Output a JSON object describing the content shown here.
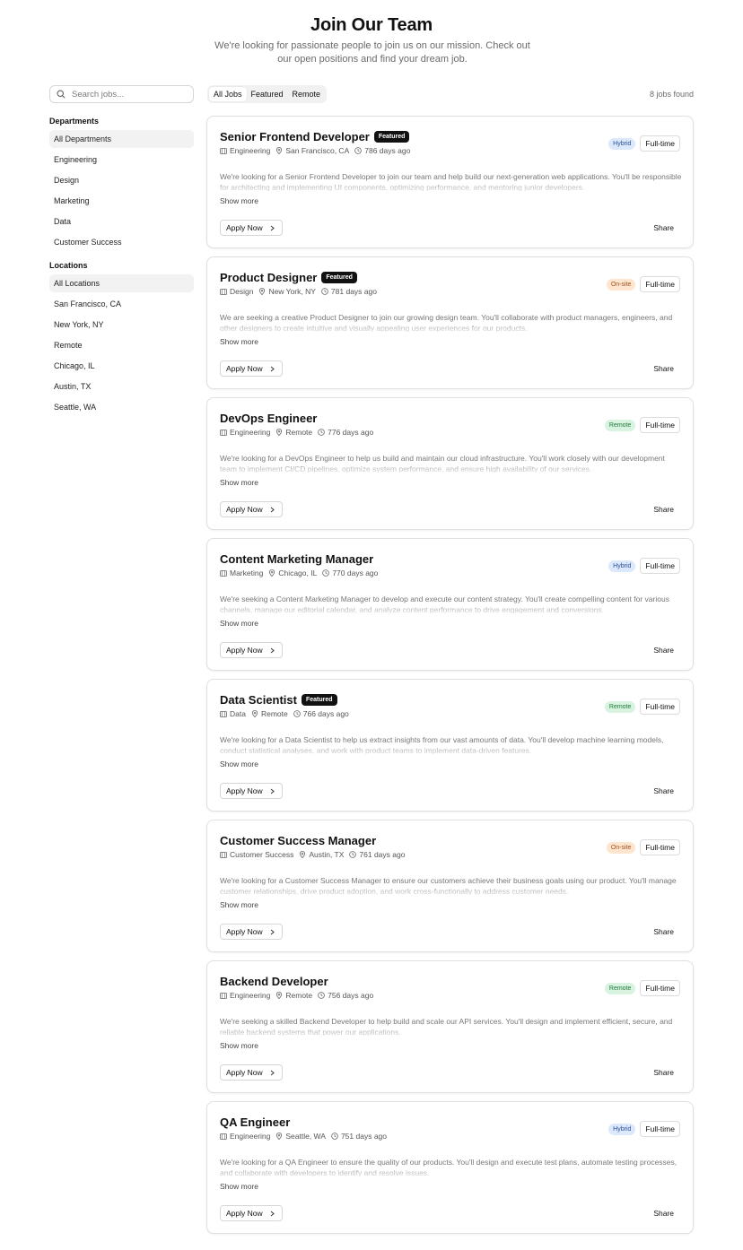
{
  "header": {
    "title": "Join Our Team",
    "subtitle": "We're looking for passionate people to join us on our mission. Check out our open positions and find your dream job."
  },
  "sidebar": {
    "search_placeholder": "Search jobs...",
    "departments_heading": "Departments",
    "departments": [
      "All Departments",
      "Engineering",
      "Design",
      "Marketing",
      "Data",
      "Customer Success"
    ],
    "locations_heading": "Locations",
    "locations": [
      "All Locations",
      "San Francisco, CA",
      "New York, NY",
      "Remote",
      "Chicago, IL",
      "Austin, TX",
      "Seattle, WA"
    ]
  },
  "filters": {
    "tabs": [
      "All Jobs",
      "Featured",
      "Remote"
    ],
    "count": "8 jobs found"
  },
  "labels": {
    "show_more": "Show more",
    "apply": "Apply Now",
    "share": "Share"
  },
  "jobs": [
    {
      "title": "Senior Frontend Developer",
      "featured": "Featured",
      "department": "Engineering",
      "location": "San Francisco, CA",
      "posted": "786 days ago",
      "work_mode": "Hybrid",
      "type": "Full-time",
      "description": "We're looking for a Senior Frontend Developer to join our team and help build our next-generation web applications. You'll be responsible for architecting and implementing UI components, optimizing performance, and mentoring junior developers."
    },
    {
      "title": "Product Designer",
      "featured": "Featured",
      "department": "Design",
      "location": "New York, NY",
      "posted": "781 days ago",
      "work_mode": "On-site",
      "type": "Full-time",
      "description": "We are seeking a creative Product Designer to join our growing design team. You'll collaborate with product managers, engineers, and other designers to create intuitive and visually appealing user experiences for our products."
    },
    {
      "title": "DevOps Engineer",
      "featured": "",
      "department": "Engineering",
      "location": "Remote",
      "posted": "776 days ago",
      "work_mode": "Remote",
      "type": "Full-time",
      "description": "We're looking for a DevOps Engineer to help us build and maintain our cloud infrastructure. You'll work closely with our development team to implement CI/CD pipelines, optimize system performance, and ensure high availability of our services."
    },
    {
      "title": "Content Marketing Manager",
      "featured": "",
      "department": "Marketing",
      "location": "Chicago, IL",
      "posted": "770 days ago",
      "work_mode": "Hybrid",
      "type": "Full-time",
      "description": "We're seeking a Content Marketing Manager to develop and execute our content strategy. You'll create compelling content for various channels, manage our editorial calendar, and analyze content performance to drive engagement and conversions."
    },
    {
      "title": "Data Scientist",
      "featured": "Featured",
      "department": "Data",
      "location": "Remote",
      "posted": "766 days ago",
      "work_mode": "Remote",
      "type": "Full-time",
      "description": "We're looking for a Data Scientist to help us extract insights from our vast amounts of data. You'll develop machine learning models, conduct statistical analyses, and work with product teams to implement data-driven features."
    },
    {
      "title": "Customer Success Manager",
      "featured": "",
      "department": "Customer Success",
      "location": "Austin, TX",
      "posted": "761 days ago",
      "work_mode": "On-site",
      "type": "Full-time",
      "description": "We're looking for a Customer Success Manager to ensure our customers achieve their business goals using our product. You'll manage customer relationships, drive product adoption, and work cross-functionally to address customer needs."
    },
    {
      "title": "Backend Developer",
      "featured": "",
      "department": "Engineering",
      "location": "Remote",
      "posted": "756 days ago",
      "work_mode": "Remote",
      "type": "Full-time",
      "description": "We're seeking a skilled Backend Developer to help build and scale our API services. You'll design and implement efficient, secure, and reliable backend systems that power our applications."
    },
    {
      "title": "QA Engineer",
      "featured": "",
      "department": "Engineering",
      "location": "Seattle, WA",
      "posted": "751 days ago",
      "work_mode": "Hybrid",
      "type": "Full-time",
      "description": "We're looking for a QA Engineer to ensure the quality of our products. You'll design and execute test plans, automate testing processes, and collaborate with developers to identify and resolve issues."
    }
  ]
}
